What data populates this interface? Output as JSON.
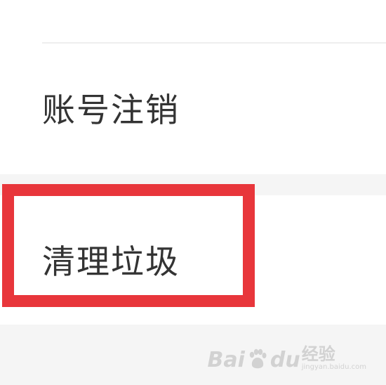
{
  "settings": {
    "items": [
      {
        "label": "账号注销"
      },
      {
        "label": "清理垃圾"
      }
    ]
  },
  "watermark": {
    "brand_left": "Bai",
    "brand_right": "du",
    "product": "经验",
    "url": "jingyan.baidu.com"
  },
  "colors": {
    "highlight": "#e8363b",
    "band": "#f5f5f5",
    "text": "#333333"
  }
}
